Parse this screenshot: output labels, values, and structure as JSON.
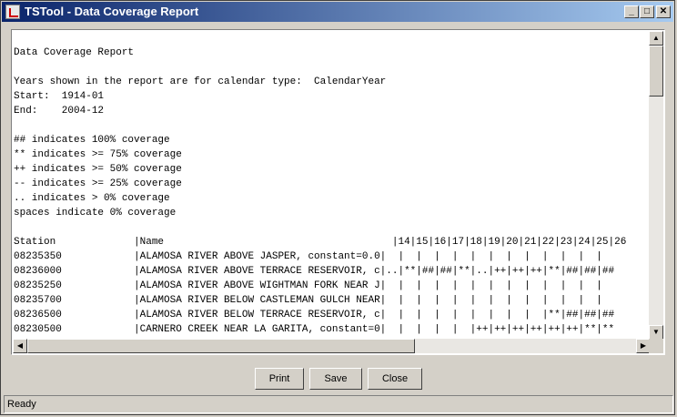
{
  "window": {
    "title": "TSTool - Data Coverage Report"
  },
  "controls": {
    "minimize": "_",
    "maximize": "□",
    "close": "✕"
  },
  "report": {
    "lines": [
      "",
      "Data Coverage Report",
      "",
      "Years shown in the report are for calendar type:  CalendarYear",
      "Start:  1914-01",
      "End:    2004-12",
      "",
      "## indicates 100% coverage",
      "** indicates >= 75% coverage",
      "++ indicates >= 50% coverage",
      "-- indicates >= 25% coverage",
      ".. indicates > 0% coverage",
      "spaces indicate 0% coverage",
      "",
      "Station             |Name                                      |14|15|16|17|18|19|20|21|22|23|24|25|26",
      "08235350            |ALAMOSA RIVER ABOVE JASPER, constant=0.0|  |  |  |  |  |  |  |  |  |  |  |  |  ",
      "08236000            |ALAMOSA RIVER ABOVE TERRACE RESERVOIR, c|..|**|##|##|**|..|++|++|++|**|##|##|##",
      "08235250            |ALAMOSA RIVER ABOVE WIGHTMAN FORK NEAR J|  |  |  |  |  |  |  |  |  |  |  |  |  ",
      "08235700            |ALAMOSA RIVER BELOW CASTLEMAN GULCH NEAR|  |  |  |  |  |  |  |  |  |  |  |  |  ",
      "08236500            |ALAMOSA RIVER BELOW TERRACE RESERVOIR, c|  |  |  |  |  |  |  |  |  |**|##|##|##",
      "08230500            |CARNERO CREEK NEAR LA GARITA, constant=0|  |  |  |  |  |++|++|++|++|++|++|**|**"
    ]
  },
  "scroll": {
    "up": "▲",
    "down": "▼",
    "left": "◀",
    "right": "▶"
  },
  "buttons": {
    "print": "Print",
    "save": "Save",
    "close": "Close"
  },
  "status": {
    "text": "Ready"
  }
}
